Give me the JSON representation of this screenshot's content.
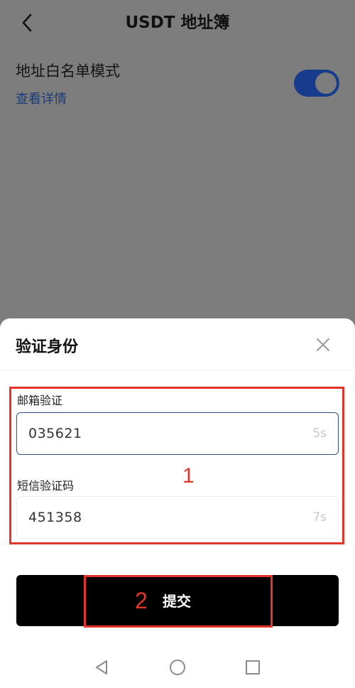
{
  "nav": {
    "title": "USDT 地址簿"
  },
  "whitelist": {
    "title": "地址白名单模式",
    "details_link": "查看详情",
    "enabled": true
  },
  "sheet": {
    "title": "验证身份",
    "email": {
      "label": "邮箱验证",
      "value": "035621",
      "timer": "5s"
    },
    "sms": {
      "label": "短信验证码",
      "value": "451358",
      "timer": "7s"
    },
    "submit_label": "提交"
  },
  "annotations": {
    "step1": "1",
    "step2": "2"
  },
  "colors": {
    "accent": "#173c8c",
    "annotation": "#e4352a",
    "submit": "#000000"
  }
}
